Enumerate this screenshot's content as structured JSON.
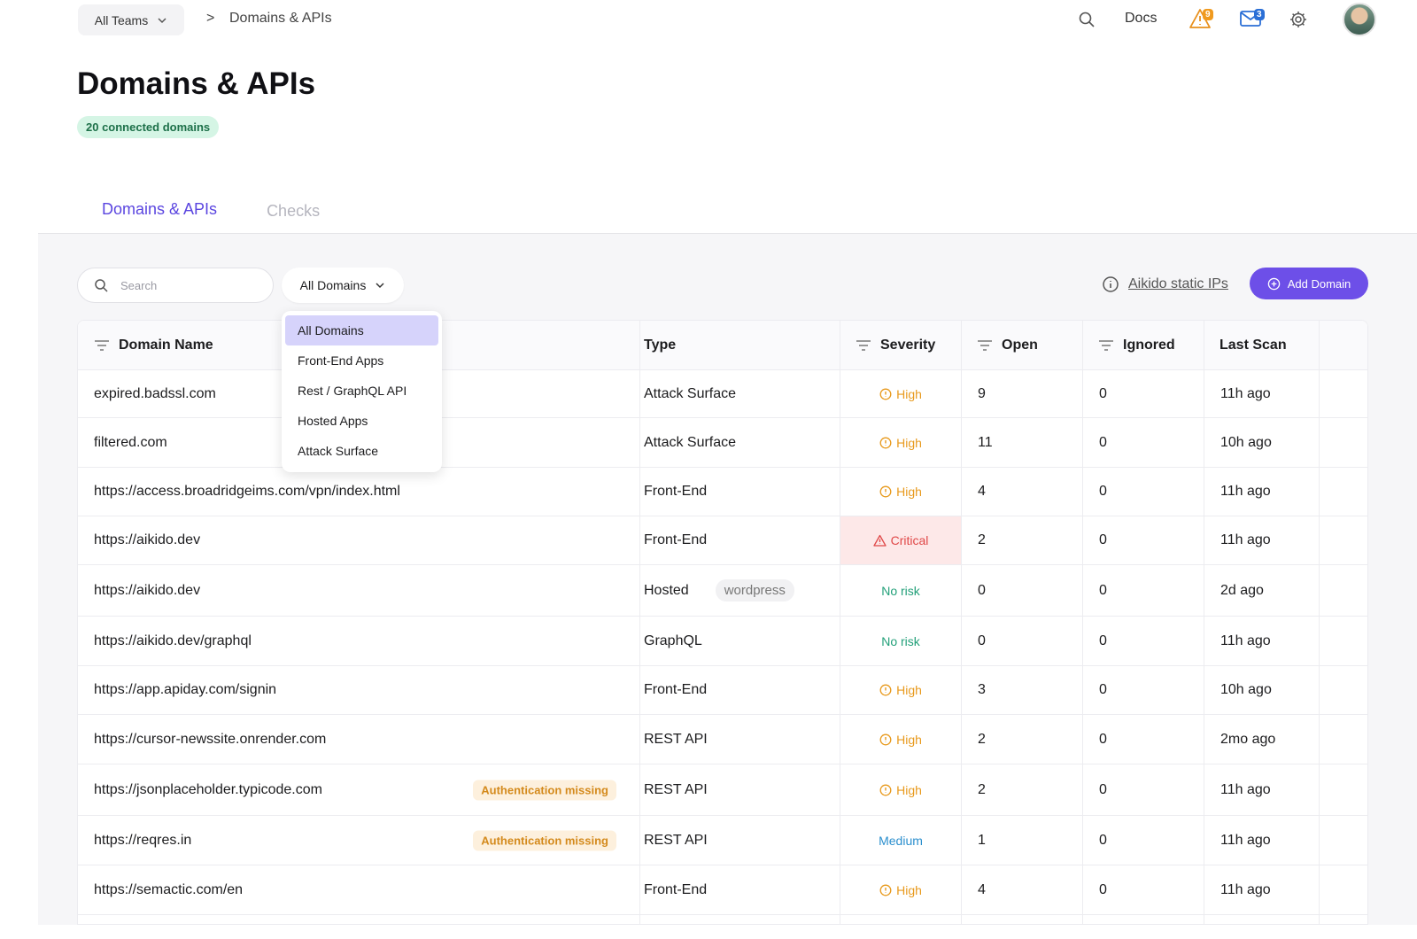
{
  "header": {
    "team_select": "All Teams",
    "breadcrumb_sep": ">",
    "breadcrumb": "Domains & APIs",
    "docs": "Docs",
    "alerts_count": "9",
    "messages_count": "3"
  },
  "page": {
    "title": "Domains & APIs",
    "count_badge": "20 connected domains"
  },
  "tabs": [
    {
      "label": "Domains & APIs"
    },
    {
      "label": "Checks"
    }
  ],
  "toolbar": {
    "search_placeholder": "Search",
    "filter_label": "All Domains",
    "static_ips_label": "Aikido static IPs",
    "add_label": "Add Domain"
  },
  "dropdown": {
    "options": [
      "All Domains",
      "Front-End Apps",
      "Rest / GraphQL API",
      "Hosted Apps",
      "Attack Surface"
    ]
  },
  "table": {
    "headers": {
      "domain": "Domain Name",
      "type": "Type",
      "severity": "Severity",
      "open": "Open",
      "ignored": "Ignored",
      "last_scan": "Last Scan"
    },
    "rows": [
      {
        "domain": "expired.badssl.com",
        "type": "Attack Surface",
        "severity": "High",
        "open": "9",
        "ignored": "0",
        "last_scan": "11h ago"
      },
      {
        "domain": "filtered.com",
        "type": "Attack Surface",
        "severity": "High",
        "open": "11",
        "ignored": "0",
        "last_scan": "10h ago"
      },
      {
        "domain": "https://access.broadridgeims.com/vpn/index.html",
        "type": "Front-End",
        "severity": "High",
        "open": "4",
        "ignored": "0",
        "last_scan": "11h ago"
      },
      {
        "domain": "https://aikido.dev",
        "type": "Front-End",
        "severity": "Critical",
        "open": "2",
        "ignored": "0",
        "last_scan": "11h ago"
      },
      {
        "domain": "https://aikido.dev",
        "type": "Hosted",
        "tag": "wordpress",
        "severity": "No risk",
        "open": "0",
        "ignored": "0",
        "last_scan": "2d ago"
      },
      {
        "domain": "https://aikido.dev/graphql",
        "type": "GraphQL",
        "severity": "No risk",
        "open": "0",
        "ignored": "0",
        "last_scan": "11h ago"
      },
      {
        "domain": "https://app.apiday.com/signin",
        "type": "Front-End",
        "severity": "High",
        "open": "3",
        "ignored": "0",
        "last_scan": "10h ago"
      },
      {
        "domain": "https://cursor-newssite.onrender.com",
        "type": "REST API",
        "severity": "High",
        "open": "2",
        "ignored": "0",
        "last_scan": "2mo ago"
      },
      {
        "domain": "https://jsonplaceholder.typicode.com",
        "badge": "Authentication missing",
        "type": "REST API",
        "severity": "High",
        "open": "2",
        "ignored": "0",
        "last_scan": "11h ago"
      },
      {
        "domain": "https://reqres.in",
        "badge": "Authentication missing",
        "type": "REST API",
        "severity": "Medium",
        "open": "1",
        "ignored": "0",
        "last_scan": "11h ago"
      },
      {
        "domain": "https://semactic.com/en",
        "type": "Front-End",
        "severity": "High",
        "open": "4",
        "ignored": "0",
        "last_scan": "11h ago"
      }
    ]
  },
  "colors": {
    "accent": "#6d4fe8",
    "high": "#e89a1d",
    "critical": "#e04848",
    "no_risk": "#22a079",
    "medium": "#2b8fce"
  }
}
